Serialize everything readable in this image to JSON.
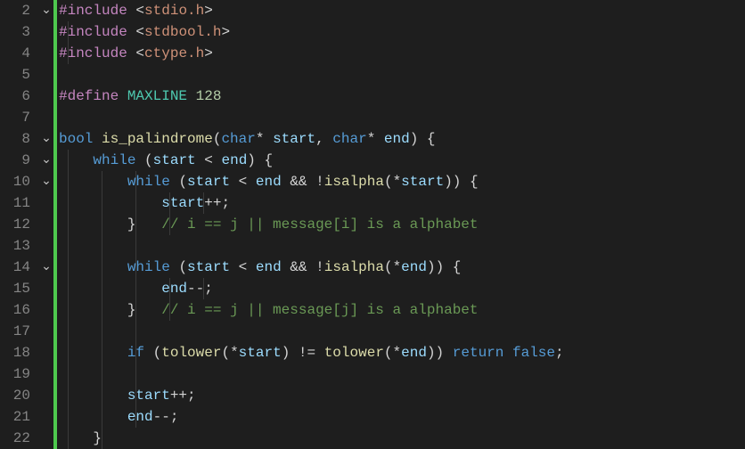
{
  "language": "c",
  "first_line_number": 2,
  "lines": [
    {
      "n": 2,
      "fold": true,
      "guides": [],
      "tokens": [
        [
          "preproc",
          "#include "
        ],
        [
          "punct",
          "<"
        ],
        [
          "string",
          "stdio.h"
        ],
        [
          "punct",
          ">"
        ]
      ]
    },
    {
      "n": 3,
      "fold": false,
      "guides": [
        1
      ],
      "tokens": [
        [
          "preproc",
          "#include "
        ],
        [
          "punct",
          "<"
        ],
        [
          "string",
          "stdbool.h"
        ],
        [
          "punct",
          ">"
        ]
      ]
    },
    {
      "n": 4,
      "fold": false,
      "guides": [
        1
      ],
      "tokens": [
        [
          "preproc",
          "#include "
        ],
        [
          "punct",
          "<"
        ],
        [
          "string",
          "ctype.h"
        ],
        [
          "punct",
          ">"
        ]
      ]
    },
    {
      "n": 5,
      "fold": false,
      "guides": [],
      "tokens": []
    },
    {
      "n": 6,
      "fold": false,
      "guides": [],
      "tokens": [
        [
          "preproc",
          "#define "
        ],
        [
          "macro",
          "MAXLINE"
        ],
        [
          "default",
          " "
        ],
        [
          "number",
          "128"
        ]
      ]
    },
    {
      "n": 7,
      "fold": false,
      "guides": [],
      "tokens": []
    },
    {
      "n": 8,
      "fold": true,
      "guides": [],
      "tokens": [
        [
          "type",
          "bool"
        ],
        [
          "default",
          " "
        ],
        [
          "func",
          "is_palindrome"
        ],
        [
          "punct",
          "("
        ],
        [
          "type",
          "char"
        ],
        [
          "op",
          "* "
        ],
        [
          "param",
          "start"
        ],
        [
          "punct",
          ", "
        ],
        [
          "type",
          "char"
        ],
        [
          "op",
          "* "
        ],
        [
          "param",
          "end"
        ],
        [
          "punct",
          ") {"
        ]
      ]
    },
    {
      "n": 9,
      "fold": true,
      "guides": [
        1
      ],
      "tokens": [
        [
          "default",
          "    "
        ],
        [
          "keyword",
          "while"
        ],
        [
          "default",
          " "
        ],
        [
          "punct",
          "("
        ],
        [
          "param",
          "start"
        ],
        [
          "default",
          " "
        ],
        [
          "op",
          "<"
        ],
        [
          "default",
          " "
        ],
        [
          "param",
          "end"
        ],
        [
          "punct",
          ") {"
        ]
      ]
    },
    {
      "n": 10,
      "fold": true,
      "guides": [
        1,
        2,
        3
      ],
      "tokens": [
        [
          "default",
          "        "
        ],
        [
          "keyword",
          "while"
        ],
        [
          "default",
          " "
        ],
        [
          "punct",
          "("
        ],
        [
          "param",
          "start"
        ],
        [
          "default",
          " "
        ],
        [
          "op",
          "<"
        ],
        [
          "default",
          " "
        ],
        [
          "param",
          "end"
        ],
        [
          "default",
          " "
        ],
        [
          "op",
          "&&"
        ],
        [
          "default",
          " "
        ],
        [
          "op",
          "!"
        ],
        [
          "func",
          "isalpha"
        ],
        [
          "punct",
          "("
        ],
        [
          "op",
          "*"
        ],
        [
          "param",
          "start"
        ],
        [
          "punct",
          ")) {"
        ]
      ]
    },
    {
      "n": 11,
      "fold": false,
      "guides": [
        1,
        2,
        3,
        4,
        5
      ],
      "tokens": [
        [
          "default",
          "            "
        ],
        [
          "param",
          "start"
        ],
        [
          "op",
          "++"
        ],
        [
          "punct",
          ";"
        ]
      ]
    },
    {
      "n": 12,
      "fold": false,
      "guides": [
        1,
        2,
        3,
        4
      ],
      "tokens": [
        [
          "default",
          "        "
        ],
        [
          "punct",
          "}"
        ],
        [
          "default",
          "   "
        ],
        [
          "comment",
          "// i == j || message[i] is a alphabet"
        ]
      ]
    },
    {
      "n": 13,
      "fold": false,
      "guides": [
        1,
        2,
        3
      ],
      "tokens": []
    },
    {
      "n": 14,
      "fold": true,
      "guides": [
        1,
        2,
        3
      ],
      "tokens": [
        [
          "default",
          "        "
        ],
        [
          "keyword",
          "while"
        ],
        [
          "default",
          " "
        ],
        [
          "punct",
          "("
        ],
        [
          "param",
          "start"
        ],
        [
          "default",
          " "
        ],
        [
          "op",
          "<"
        ],
        [
          "default",
          " "
        ],
        [
          "param",
          "end"
        ],
        [
          "default",
          " "
        ],
        [
          "op",
          "&&"
        ],
        [
          "default",
          " "
        ],
        [
          "op",
          "!"
        ],
        [
          "func",
          "isalpha"
        ],
        [
          "punct",
          "("
        ],
        [
          "op",
          "*"
        ],
        [
          "param",
          "end"
        ],
        [
          "punct",
          ")) {"
        ]
      ]
    },
    {
      "n": 15,
      "fold": false,
      "guides": [
        1,
        2,
        3,
        4,
        5
      ],
      "tokens": [
        [
          "default",
          "            "
        ],
        [
          "param",
          "end"
        ],
        [
          "op",
          "--"
        ],
        [
          "punct",
          ";"
        ]
      ]
    },
    {
      "n": 16,
      "fold": false,
      "guides": [
        1,
        2,
        3,
        4
      ],
      "tokens": [
        [
          "default",
          "        "
        ],
        [
          "punct",
          "}"
        ],
        [
          "default",
          "   "
        ],
        [
          "comment",
          "// i == j || message[j] is a alphabet"
        ]
      ]
    },
    {
      "n": 17,
      "fold": false,
      "guides": [
        1,
        2,
        3
      ],
      "tokens": []
    },
    {
      "n": 18,
      "fold": false,
      "guides": [
        1,
        2,
        3
      ],
      "tokens": [
        [
          "default",
          "        "
        ],
        [
          "keyword",
          "if"
        ],
        [
          "default",
          " "
        ],
        [
          "punct",
          "("
        ],
        [
          "func",
          "tolower"
        ],
        [
          "punct",
          "("
        ],
        [
          "op",
          "*"
        ],
        [
          "param",
          "start"
        ],
        [
          "punct",
          ") "
        ],
        [
          "op",
          "!="
        ],
        [
          "default",
          " "
        ],
        [
          "func",
          "tolower"
        ],
        [
          "punct",
          "("
        ],
        [
          "op",
          "*"
        ],
        [
          "param",
          "end"
        ],
        [
          "punct",
          ")) "
        ],
        [
          "keyword",
          "return"
        ],
        [
          "default",
          " "
        ],
        [
          "const",
          "false"
        ],
        [
          "punct",
          ";"
        ]
      ]
    },
    {
      "n": 19,
      "fold": false,
      "guides": [
        1,
        2,
        3
      ],
      "tokens": []
    },
    {
      "n": 20,
      "fold": false,
      "guides": [
        1,
        2,
        3
      ],
      "tokens": [
        [
          "default",
          "        "
        ],
        [
          "param",
          "start"
        ],
        [
          "op",
          "++"
        ],
        [
          "punct",
          ";"
        ]
      ]
    },
    {
      "n": 21,
      "fold": false,
      "guides": [
        1,
        2,
        3
      ],
      "tokens": [
        [
          "default",
          "        "
        ],
        [
          "param",
          "end"
        ],
        [
          "op",
          "--"
        ],
        [
          "punct",
          ";"
        ]
      ]
    },
    {
      "n": 22,
      "fold": false,
      "guides": [
        1,
        2
      ],
      "tokens": [
        [
          "default",
          "    "
        ],
        [
          "punct",
          "}"
        ]
      ]
    }
  ],
  "labels": {
    "gutter": "line-numbers",
    "fold": "fold-column",
    "code": "code-area"
  }
}
